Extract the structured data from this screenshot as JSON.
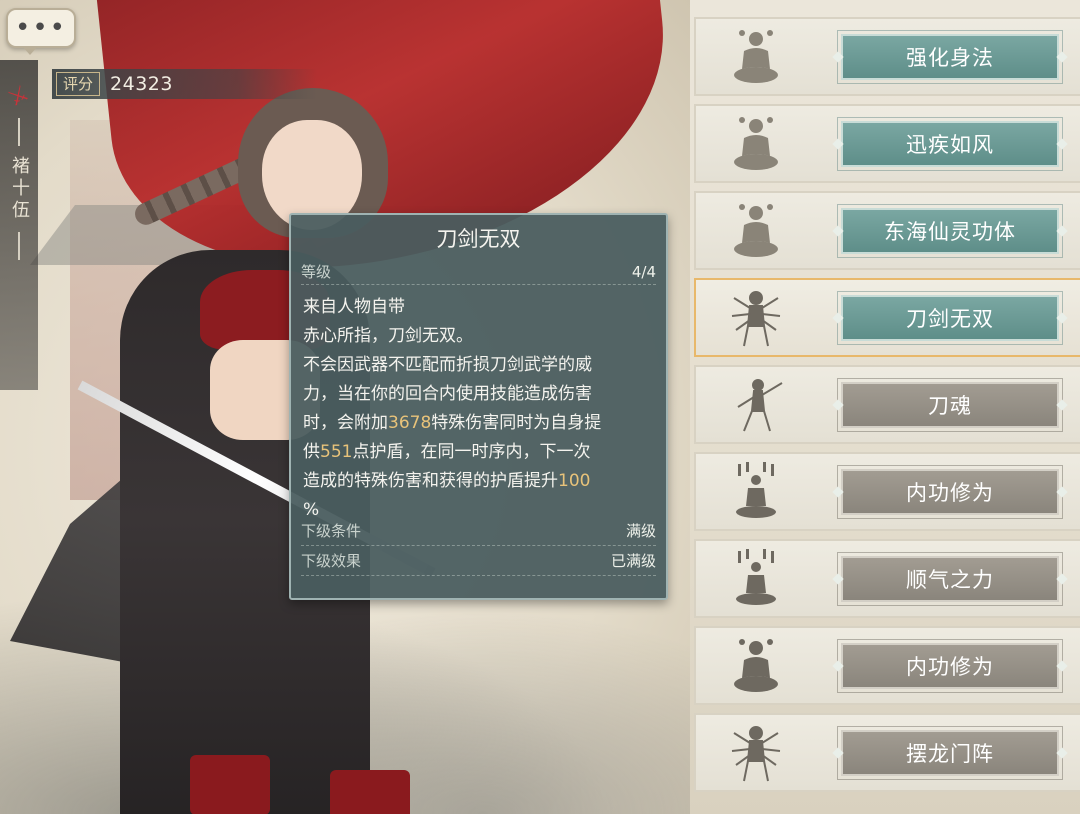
{
  "chat_button": {
    "label": "•••"
  },
  "character": {
    "name": "褚十伍",
    "score_label": "评分",
    "score_value": "24323"
  },
  "tooltip": {
    "title": "刀剑无双",
    "level_label": "等级",
    "level_value": "4/4",
    "desc_lines": [
      "来自人物自带",
      "赤心所指，刀剑无双。",
      "不会因武器不匹配而折损刀剑武学的威",
      "力，当在你的回合内使用技能造成伤害",
      "时，会附加",
      "3678",
      "特殊伤害同时为自身提",
      "供",
      "551",
      "点护盾，在同一时序内，下一次",
      "造成的特殊伤害和获得的护盾提升",
      "100",
      "%"
    ],
    "next_condition_label": "下级条件",
    "next_condition_value": "满级",
    "next_effect_label": "下级效果",
    "next_effect_value": "已满级"
  },
  "skills": [
    {
      "label": "强化身法",
      "state": "active",
      "icon": "meditating-monk-icon"
    },
    {
      "label": "迅疾如风",
      "state": "active",
      "icon": "meditating-monk-icon"
    },
    {
      "label": "东海仙灵功体",
      "state": "active",
      "icon": "meditating-monk-icon"
    },
    {
      "label": "刀剑无双",
      "state": "active",
      "icon": "multi-arm-warrior-icon",
      "selected": true
    },
    {
      "label": "刀魂",
      "state": "locked",
      "icon": "sword-dancer-icon"
    },
    {
      "label": "内功修为",
      "state": "locked",
      "icon": "internal-energy-icon"
    },
    {
      "label": "顺气之力",
      "state": "locked",
      "icon": "internal-energy-icon"
    },
    {
      "label": "内功修为",
      "state": "locked",
      "icon": "meditating-monk-icon"
    },
    {
      "label": "摆龙门阵",
      "state": "locked",
      "icon": "multi-arm-warrior-icon"
    }
  ],
  "colors": {
    "active_button": "#6f9c97",
    "locked_button": "#958f86",
    "highlight_number": "#e8c37a",
    "tooltip_bg": "#495c5f"
  }
}
